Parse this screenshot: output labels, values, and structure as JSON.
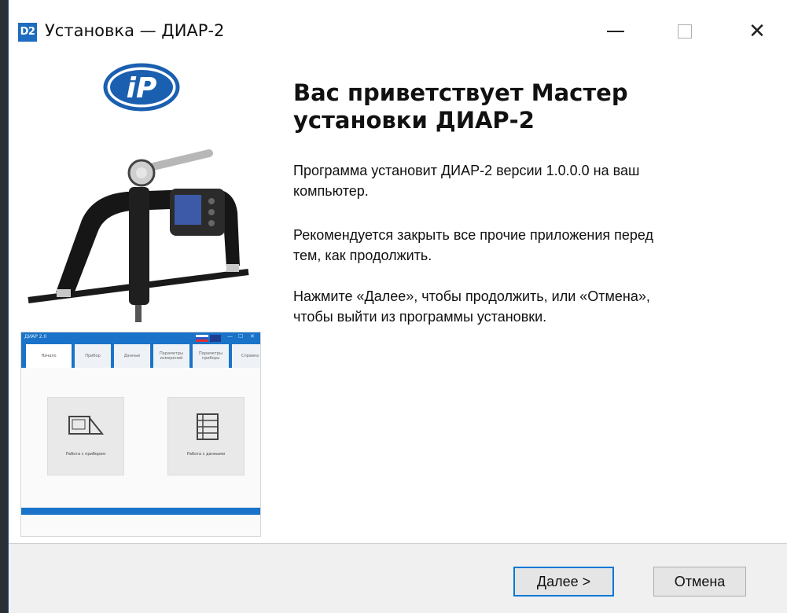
{
  "window": {
    "icon_text": "D2",
    "title": "Установка — ДИАР-2",
    "controls": {
      "minimize": "minimize-icon",
      "maximize": "maximize-icon",
      "close": "close-icon",
      "close_glyph": "✕"
    }
  },
  "sidebar": {
    "logo_text": "iP",
    "app_preview": {
      "title": "ДИАР 2.0",
      "window_controls": [
        "—",
        "☐",
        "✕"
      ],
      "tabs": [
        "Начало",
        "Прибор",
        "Данные",
        "Параметры измерений",
        "Параметры прибора",
        "Справка"
      ],
      "cards": [
        "Работа с прибором",
        "Работа с данными"
      ]
    }
  },
  "main": {
    "heading": "Вас приветствует Мастер установки ДИАР-2",
    "paragraph1": "Программа установит ДИАР-2 версии 1.0.0.0 на ваш\nкомпьютер.",
    "paragraph2": "Рекомендуется закрыть все прочие приложения перед\nтем, как продолжить.",
    "paragraph3": "Нажмите «Далее», чтобы продолжить, или «Отмена»,\nчтобы выйти из программы установки."
  },
  "footer": {
    "next_label": "Далее >",
    "cancel_label": "Отмена"
  },
  "colors": {
    "accent": "#0078d7",
    "brand_blue": "#1a73c8",
    "footer_bg": "#f0f0f0"
  }
}
